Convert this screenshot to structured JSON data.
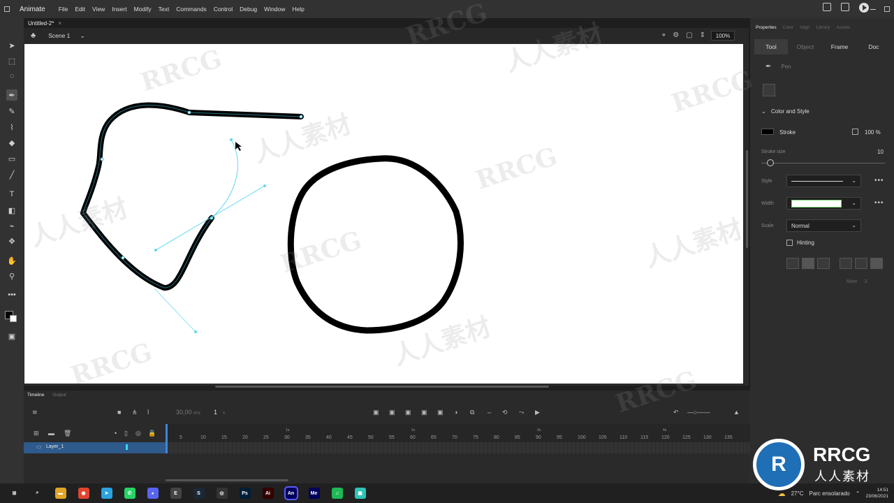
{
  "app": {
    "name": "Animate"
  },
  "menu": [
    "File",
    "Edit",
    "View",
    "Insert",
    "Modify",
    "Text",
    "Commands",
    "Control",
    "Debug",
    "Window",
    "Help"
  ],
  "document": {
    "tab": "Untitled-2*",
    "close": "×",
    "scene": "Scene 1",
    "zoom": "100%"
  },
  "properties": {
    "tabs": [
      "Properties",
      "Color",
      "Align",
      "Library",
      "Assets"
    ],
    "subtabs": [
      "Tool",
      "Object",
      "Frame",
      "Doc"
    ],
    "tool_name": "Pen",
    "section": "Color and Style",
    "stroke_label": "Stroke",
    "stroke_color": "#000000",
    "alpha": "100 %",
    "stroke_size_label": "Stroke size",
    "stroke_size": "10",
    "style_label": "Style",
    "width_label": "Width",
    "scale_label": "Scale",
    "scale_value": "Normal",
    "hinting_label": "Hinting",
    "miter_label": "Miter",
    "miter_value": "3"
  },
  "timeline": {
    "tabs": [
      "Timeline",
      "Output"
    ],
    "fps": "30,00",
    "fps_unit": "FPS",
    "frame": "1",
    "frame_unit": "F",
    "ruler": [
      "5",
      "10",
      "15",
      "20",
      "25",
      "30",
      "35",
      "40",
      "45",
      "50",
      "55",
      "60",
      "65",
      "70",
      "75",
      "80",
      "85",
      "90",
      "95",
      "100",
      "105",
      "110",
      "115",
      "120",
      "125",
      "130",
      "135"
    ],
    "seconds": [
      "1s",
      "2s",
      "3s",
      "4s"
    ],
    "layer": "Layer_1"
  },
  "taskbar": {
    "weather_temp": "27°C",
    "weather_text": "Parc ensolarado",
    "time": "14:51",
    "date": "23/06/2021",
    "apps": [
      {
        "label": "⊞",
        "color": "#202020"
      },
      {
        "label": "⌕",
        "color": "#202020"
      },
      {
        "label": "▬",
        "color": "#e0a526"
      },
      {
        "label": "◉",
        "color": "#e0452f"
      },
      {
        "label": "➤",
        "color": "#2aa3e0"
      },
      {
        "label": "✆",
        "color": "#25d366"
      },
      {
        "label": "◕",
        "color": "#5865f2"
      },
      {
        "label": "E",
        "color": "#444444"
      },
      {
        "label": "S",
        "color": "#1b2838"
      },
      {
        "label": "◎",
        "color": "#333333"
      },
      {
        "label": "Ps",
        "color": "#001e36"
      },
      {
        "label": "Ai",
        "color": "#330000"
      },
      {
        "label": "An",
        "color": "#00005b"
      },
      {
        "label": "Me",
        "color": "#00005b"
      },
      {
        "label": "♫",
        "color": "#1db954"
      },
      {
        "label": "▣",
        "color": "#2ec4b6"
      }
    ]
  },
  "watermark": {
    "text": "RRCG",
    "cn": "人人素材"
  },
  "colors": {
    "accent": "#3d86d9",
    "panel": "#2d2d2d",
    "canvas": "#ffffff",
    "path_guide": "#5fd8ef"
  }
}
